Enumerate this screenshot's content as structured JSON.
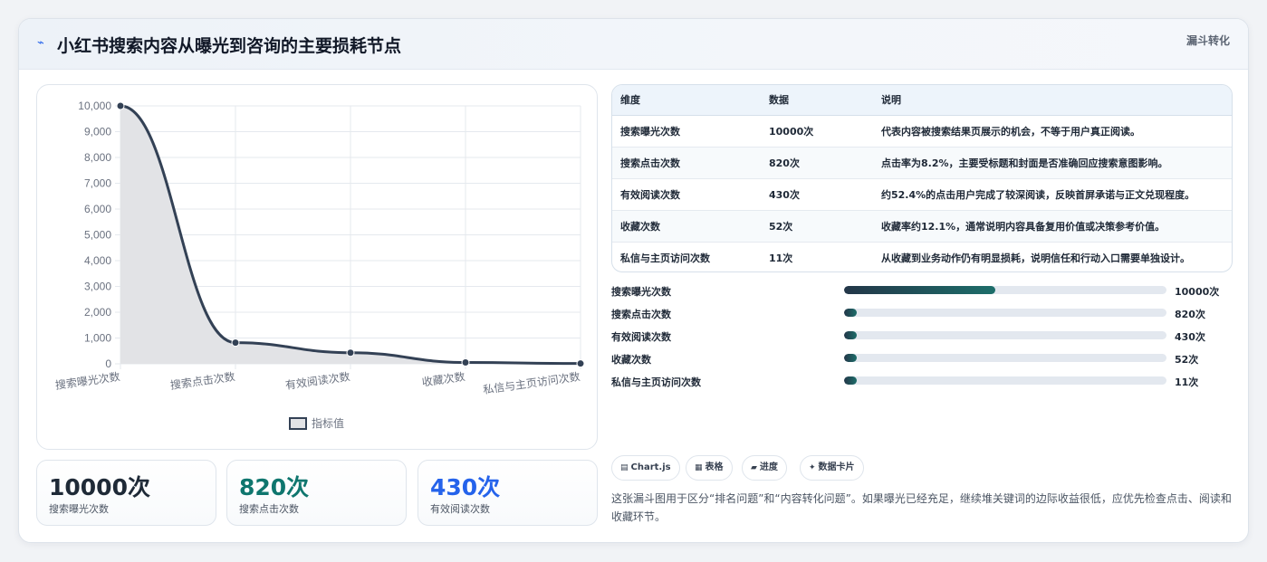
{
  "header": {
    "icon": "pulse-icon",
    "title": "小红书搜索内容从曝光到咨询的主要损耗节点",
    "tag": "漏斗转化"
  },
  "chart_data": {
    "type": "area",
    "categories": [
      "搜索曝光次数",
      "搜索点击次数",
      "有效阅读次数",
      "收藏次数",
      "私信与主页访问次数"
    ],
    "series": [
      {
        "name": "指标值",
        "values": [
          10000,
          820,
          430,
          52,
          11
        ]
      }
    ],
    "y_ticks": [
      "10,000",
      "9,000",
      "8,000",
      "7,000",
      "6,000",
      "5,000",
      "4,000",
      "3,000",
      "2,000",
      "1,000",
      "0"
    ],
    "ylim": [
      0,
      10000
    ],
    "grid": true,
    "legend": "bottom",
    "colors": {
      "line": "#334155",
      "fill": "#e2e3e6"
    }
  },
  "kpis": [
    {
      "value": "10000次",
      "label": "搜索曝光次数",
      "color": "#1f2a37"
    },
    {
      "value": "820次",
      "label": "搜索点击次数",
      "color": "#0f766e"
    },
    {
      "value": "430次",
      "label": "有效阅读次数",
      "color": "#2563eb"
    }
  ],
  "table": {
    "headers": [
      "维度",
      "数据",
      "说明"
    ],
    "rows": [
      [
        "搜索曝光次数",
        "10000次",
        "代表内容被搜索结果页展示的机会，不等于用户真正阅读。"
      ],
      [
        "搜索点击次数",
        "820次",
        "点击率为8.2%，主要受标题和封面是否准确回应搜索意图影响。"
      ],
      [
        "有效阅读次数",
        "430次",
        "约52.4%的点击用户完成了较深阅读，反映首屏承诺与正文兑现程度。"
      ],
      [
        "收藏次数",
        "52次",
        "收藏率约12.1%，通常说明内容具备复用价值或决策参考价值。"
      ],
      [
        "私信与主页访问次数",
        "11次",
        "从收藏到业务动作仍有明显损耗，说明信任和行动入口需要单独设计。"
      ]
    ]
  },
  "progress": [
    {
      "label": "搜索曝光次数",
      "value": "10000次",
      "fraction": 0.47
    },
    {
      "label": "搜索点击次数",
      "value": "820次",
      "fraction": 0.039
    },
    {
      "label": "有效阅读次数",
      "value": "430次",
      "fraction": 0.039
    },
    {
      "label": "收藏次数",
      "value": "52次",
      "fraction": 0.039
    },
    {
      "label": "私信与主页访问次数",
      "value": "11次",
      "fraction": 0.039
    }
  ],
  "chips": [
    {
      "icon": "▤",
      "icon_name": "chart-icon",
      "label": "Chart.js"
    },
    {
      "icon": "▦",
      "icon_name": "table-icon",
      "label": "表格"
    },
    {
      "icon": "▰",
      "icon_name": "progress-icon",
      "label": "进度"
    },
    {
      "icon": "✦",
      "icon_name": "sparkle-icon",
      "label": "数据卡片"
    }
  ],
  "note": "这张漏斗图用于区分“排名问题”和“内容转化问题”。如果曝光已经充足，继续堆关键词的边际收益很低，应优先检查点击、阅读和收藏环节。"
}
